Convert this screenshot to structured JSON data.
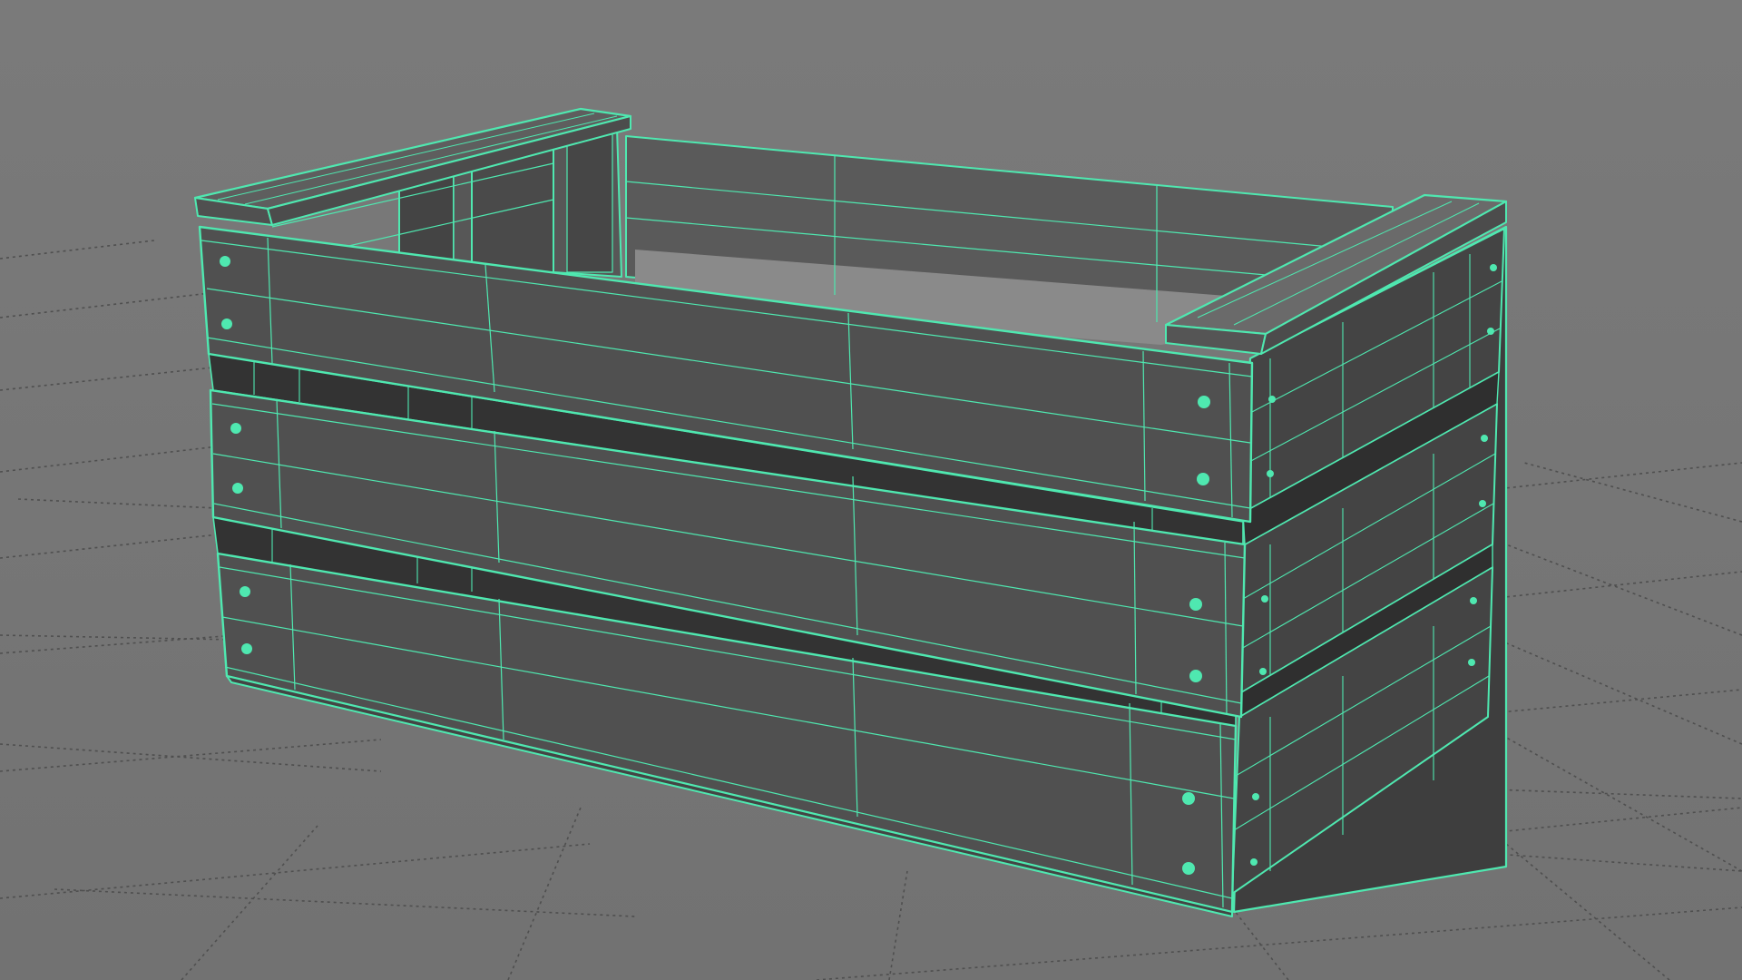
{
  "viewport": {
    "background_color": "#767676",
    "grid_color": "#4f4f4f",
    "selection_color": "#4fe8b0",
    "face_color": "#535353",
    "face_dark_color": "#3c3c3c"
  },
  "object": {
    "semantic": "wooden-crate-mesh",
    "state": "selected",
    "display_mode": "wireframe-on-shaded"
  }
}
